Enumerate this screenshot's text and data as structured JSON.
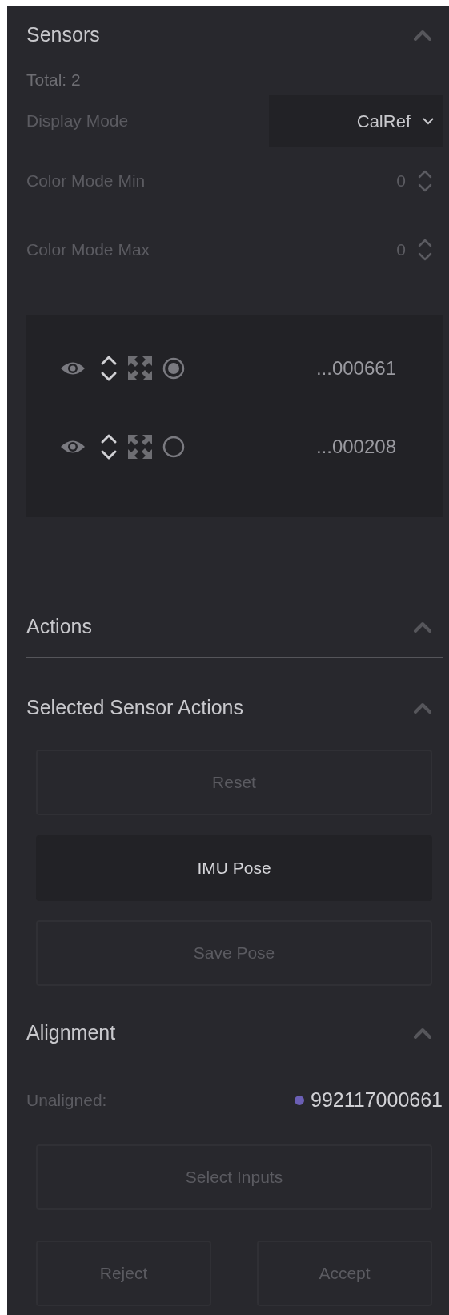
{
  "sensors": {
    "title": "Sensors",
    "expanded": true,
    "total": "Total: 2",
    "display_mode": {
      "label": "Display Mode",
      "value": "CalRef"
    },
    "color_mode_min": {
      "label": "Color Mode Min",
      "value": "0"
    },
    "color_mode_max": {
      "label": "Color Mode Max",
      "value": "0"
    },
    "list": [
      {
        "id": "...000661",
        "selected": true
      },
      {
        "id": "...000208",
        "selected": false
      }
    ]
  },
  "actions": {
    "title": "Actions",
    "expanded": true
  },
  "selected_sensor_actions": {
    "title": "Selected Sensor Actions",
    "expanded": true,
    "buttons": [
      {
        "label": "Reset",
        "disabled": true
      },
      {
        "label": "IMU Pose",
        "disabled": false
      },
      {
        "label": "Save Pose",
        "disabled": true
      }
    ]
  },
  "alignment": {
    "title": "Alignment",
    "expanded": true,
    "unaligned_label": "Unaligned:",
    "unaligned": [
      {
        "id": "992117000661",
        "color": "#6b5fb5"
      }
    ],
    "buttons": [
      {
        "label": "Select Inputs",
        "disabled": true
      },
      {
        "label": "Reject",
        "disabled": true
      },
      {
        "label": "Accept",
        "disabled": true
      }
    ]
  }
}
